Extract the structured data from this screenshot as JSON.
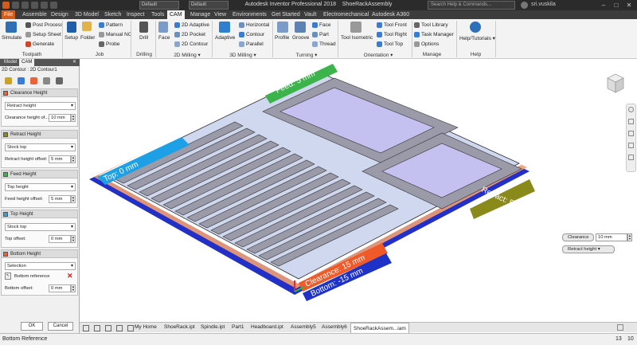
{
  "app": {
    "title": "Autodesk Inventor Professional 2018",
    "document": "ShoeRackAssembly",
    "search_placeholder": "Search Help & Commands...",
    "user": "sri.vuskila",
    "combo_material": "Default",
    "combo_appearance": "Default"
  },
  "menu_tabs": [
    {
      "label": "File"
    },
    {
      "label": "Assemble"
    },
    {
      "label": "Design"
    },
    {
      "label": "3D Model"
    },
    {
      "label": "Sketch"
    },
    {
      "label": "Inspect"
    },
    {
      "label": "Tools"
    },
    {
      "label": "CAM"
    },
    {
      "label": "Manage"
    },
    {
      "label": "View"
    },
    {
      "label": "Environments"
    },
    {
      "label": "Get Started"
    },
    {
      "label": "Vault"
    },
    {
      "label": "Electromechanical"
    },
    {
      "label": "Autodesk A360"
    }
  ],
  "ribbon": {
    "simulate": "Simulate",
    "post_process": "Post Process",
    "setup_sheet": "Setup Sheet",
    "generate": "Generate",
    "toolpath_group": "Toolpath",
    "setup": "Setup",
    "folder": "Folder",
    "pattern": "Pattern",
    "manual_nc": "Manual NC",
    "probe": "Probe",
    "job_group": "Job",
    "drill": "Drill",
    "drilling_group": "Drilling",
    "face": "Face",
    "adaptive_2d": "2D Adaptive",
    "pocket_2d": "2D Pocket",
    "contour_2d": "2D Contour",
    "milling_2d_group": "2D Milling",
    "adaptive": "Adaptive",
    "horizontal": "Horizontal",
    "contour": "Contour",
    "parallel": "Parallel",
    "milling_3d_group": "3D Milling",
    "profile": "Profile",
    "groove": "Groove",
    "turn_face": "Face",
    "part": "Part",
    "thread": "Thread",
    "turning_group": "Turning",
    "tool_isometric": "Tool Isometric",
    "tool_front": "Tool Front",
    "tool_right": "Tool Right",
    "tool_top": "Tool Top",
    "orientation_group": "Orientation",
    "tool_library": "Tool Library",
    "task_manager": "Task Manager",
    "options": "Options",
    "manage_group": "Manage",
    "help_tutorials": "Help/Tutorials",
    "help_group": "Help"
  },
  "panel": {
    "tabs": [
      {
        "label": "Model"
      },
      {
        "label": "CAM"
      }
    ],
    "breadcrumb": "2D Contour : 2D Contour1",
    "sections": [
      {
        "title": "Clearance Height",
        "color": "#e8643a",
        "select": "Retract height",
        "field_label": "Clearance height of...",
        "field_value": "10 mm"
      },
      {
        "title": "Retract Height",
        "color": "#8a8a1a",
        "select": "Stock top",
        "field_label": "Retract height offset:",
        "field_value": "5 mm"
      },
      {
        "title": "Feed Height",
        "color": "#3cb44b",
        "select": "Top height",
        "field_label": "Feed height offset:",
        "field_value": "5 mm"
      },
      {
        "title": "Top Height",
        "color": "#3ca0dc",
        "select": "Stock top",
        "field_label": "Top offset:",
        "field_value": "0 mm"
      },
      {
        "title": "Bottom Height",
        "color": "#e8643a",
        "select": "Selection",
        "ref_label": "Bottom reference",
        "field_label": "Bottom offset:",
        "field_value": "0 mm"
      }
    ],
    "ok": "OK",
    "cancel": "Cancel"
  },
  "viewport": {
    "labels": {
      "feed": "Feed: 5 mm",
      "top": "Top: 0 mm",
      "retract": "Retract: 5 mm",
      "clearance": "Clearance: 15 mm",
      "bottom": "Bottom: -15 mm"
    },
    "colors": {
      "feed": "#3cb44b",
      "top": "#1ea0e6",
      "retract": "#8a8a1a",
      "clearance": "#f05a28",
      "bottom": "#1e32c8"
    },
    "chips": {
      "clearance": "Clearance",
      "clearance_value": "10 mm",
      "retract": "Retract height"
    }
  },
  "doc_tabs": [
    {
      "label": "My Home"
    },
    {
      "label": "ShoeRack.ipt"
    },
    {
      "label": "Spindle.ipt"
    },
    {
      "label": "Part1"
    },
    {
      "label": "Headboard.ipt"
    },
    {
      "label": "Assembly5"
    },
    {
      "label": "Assembly6"
    },
    {
      "label": "ShoeRackAssem...iam"
    }
  ],
  "status": {
    "text": "Bottom Reference",
    "n1": "13",
    "n2": "10"
  }
}
